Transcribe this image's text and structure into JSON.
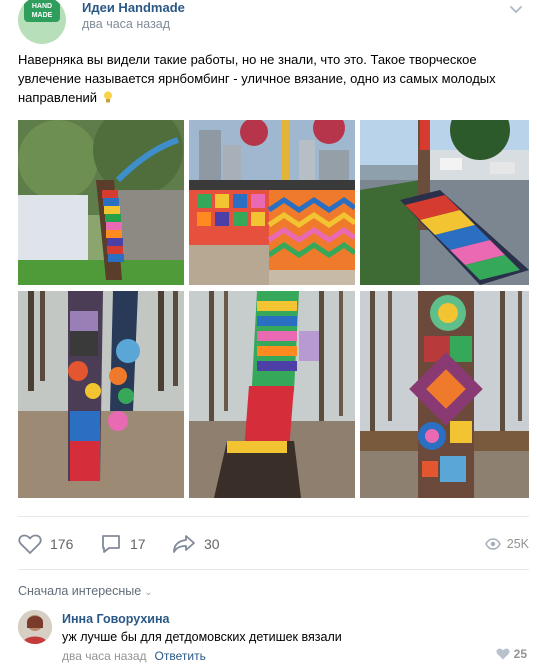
{
  "post": {
    "group_name": "Идеи Handmade",
    "time": "два часа назад",
    "avatar_badge": "HAND MADE",
    "text": "Наверняка вы видели такие работы, но не знали, что это. Такое творческое увлечение называется ярнбомбинг - уличное вязание, одно из самых молодых направлений",
    "photos": [
      {
        "name": "photo-tree-striped"
      },
      {
        "name": "photo-bridge-railing"
      },
      {
        "name": "photo-bench"
      },
      {
        "name": "photo-tree-circles"
      },
      {
        "name": "photo-tree-stocking"
      },
      {
        "name": "photo-tree-granny-squares"
      }
    ]
  },
  "actions": {
    "likes": "176",
    "comments": "17",
    "shares": "30",
    "views": "25K"
  },
  "comments": {
    "sort_label": "Сначала интересные",
    "items": [
      {
        "author": "Инна Говорухина",
        "text": "уж лучше бы для детдомовских детишек вязали",
        "time": "два часа назад",
        "reply_label": "Ответить",
        "likes": "25"
      }
    ]
  },
  "colors": {
    "link": "#2a5885",
    "muted": "#818c99",
    "divider": "#e7e8ec"
  }
}
